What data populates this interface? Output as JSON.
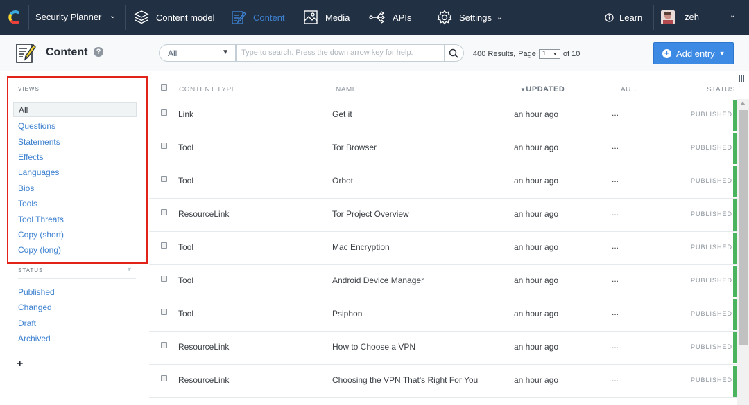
{
  "topbar": {
    "space_name": "Security Planner",
    "nav": [
      {
        "label": "Content model",
        "icon": "cubes-icon"
      },
      {
        "label": "Content",
        "icon": "content-icon",
        "active": true
      },
      {
        "label": "Media",
        "icon": "media-icon"
      },
      {
        "label": "APIs",
        "icon": "apis-icon"
      },
      {
        "label": "Settings",
        "icon": "gear-icon"
      }
    ],
    "learn_label": "Learn",
    "user_name": "zeh",
    "accent_color": "#3c80cf",
    "background_color": "#223044"
  },
  "header": {
    "title": "Content",
    "help_glyph": "?",
    "filter_value": "All",
    "search_placeholder": "Type to search. Press the down arrow key for help.",
    "results_text": "400 Results,",
    "page_label": "Page",
    "page_value": "1",
    "page_of": "of 10",
    "add_entry_label": "Add entry"
  },
  "sidebar": {
    "views_heading": "VIEWS",
    "views": [
      "All",
      "Questions",
      "Statements",
      "Effects",
      "Languages",
      "Bios",
      "Tools",
      "Tool Threats",
      "Copy (short)",
      "Copy (long)"
    ],
    "selected_view": "All",
    "status_heading": "STATUS",
    "statuses": [
      "Published",
      "Changed",
      "Draft",
      "Archived"
    ],
    "add_glyph": "+"
  },
  "table": {
    "columns": {
      "content_type": "CONTENT TYPE",
      "name": "NAME",
      "updated": "UPDATED",
      "author": "AU...",
      "status": "STATUS"
    },
    "rows": [
      {
        "type": "Link",
        "name": "Get it",
        "updated": "an hour ago",
        "author": "...",
        "status": "PUBLISHED"
      },
      {
        "type": "Tool",
        "name": "Tor Browser",
        "updated": "an hour ago",
        "author": "...",
        "status": "PUBLISHED"
      },
      {
        "type": "Tool",
        "name": "Orbot",
        "updated": "an hour ago",
        "author": "...",
        "status": "PUBLISHED"
      },
      {
        "type": "ResourceLink",
        "name": "Tor Project Overview",
        "updated": "an hour ago",
        "author": "...",
        "status": "PUBLISHED"
      },
      {
        "type": "Tool",
        "name": "Mac Encryption",
        "updated": "an hour ago",
        "author": "...",
        "status": "PUBLISHED"
      },
      {
        "type": "Tool",
        "name": "Android Device Manager",
        "updated": "an hour ago",
        "author": "...",
        "status": "PUBLISHED"
      },
      {
        "type": "Tool",
        "name": "Psiphon",
        "updated": "an hour ago",
        "author": "...",
        "status": "PUBLISHED"
      },
      {
        "type": "ResourceLink",
        "name": "How to Choose a VPN",
        "updated": "an hour ago",
        "author": "...",
        "status": "PUBLISHED"
      },
      {
        "type": "ResourceLink",
        "name": "Choosing the VPN That's Right For You",
        "updated": "an hour ago",
        "author": "...",
        "status": "PUBLISHED"
      }
    ],
    "published_color": "#49b35d",
    "highlight_color": "#e2231a"
  }
}
